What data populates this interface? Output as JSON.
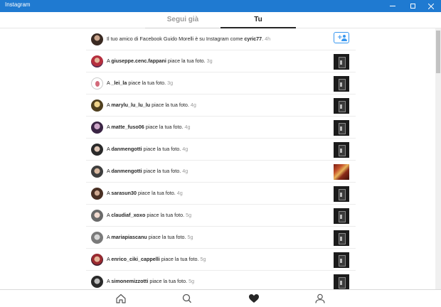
{
  "window": {
    "title": "Instagram"
  },
  "tabs": {
    "following": "Segui già",
    "you": "Tu"
  },
  "feed": [
    {
      "prefix": "Il tuo amico di Facebook Guido Morelli è su Instagram come ",
      "user": "cyric77",
      "action": ".",
      "time": "4h",
      "type": "follow"
    },
    {
      "prefix": "A ",
      "user": "giuseppe.cenc.fappani",
      "action": " piace la tua foto.",
      "time": "3g",
      "type": "like"
    },
    {
      "prefix": "A ",
      "user": "_lei_la",
      "action": " piace la tua foto.",
      "time": "3g",
      "type": "like"
    },
    {
      "prefix": "A ",
      "user": "marylu_lu_lu_lu",
      "action": " piace la tua foto.",
      "time": "4g",
      "type": "like"
    },
    {
      "prefix": "A ",
      "user": "matte_fuso06",
      "action": " piace la tua foto.",
      "time": "4g",
      "type": "like"
    },
    {
      "prefix": "A ",
      "user": "danmengotti",
      "action": " piace la tua foto.",
      "time": "4g",
      "type": "like"
    },
    {
      "prefix": "A ",
      "user": "danmengotti",
      "action": " piace la tua foto.",
      "time": "4g",
      "type": "like",
      "thumb": "color"
    },
    {
      "prefix": "A ",
      "user": "sarasun30",
      "action": " piace la tua foto.",
      "time": "4g",
      "type": "like"
    },
    {
      "prefix": "A ",
      "user": "claudiaf_xoxo",
      "action": " piace la tua foto.",
      "time": "5g",
      "type": "like"
    },
    {
      "prefix": "A ",
      "user": "mariapiascanu",
      "action": " piace la tua foto.",
      "time": "5g",
      "type": "like"
    },
    {
      "prefix": "A ",
      "user": "enrico_ciki_cappelli",
      "action": " piace la tua foto.",
      "time": "5g",
      "type": "like"
    },
    {
      "prefix": "A ",
      "user": "simonemizzotti",
      "action": " piace la tua foto.",
      "time": "5g",
      "type": "like"
    }
  ],
  "icons": {
    "minimize": "minimize-icon",
    "maximize": "maximize-icon",
    "close": "close-icon",
    "home": "home-icon",
    "search": "search-icon",
    "activity": "heart-icon",
    "profile": "profile-icon",
    "follow": "add-person-icon"
  },
  "colors": {
    "titlebar": "#1f7ad1",
    "accent": "#3897f0",
    "text": "#262626",
    "muted": "#9a9a9a"
  }
}
